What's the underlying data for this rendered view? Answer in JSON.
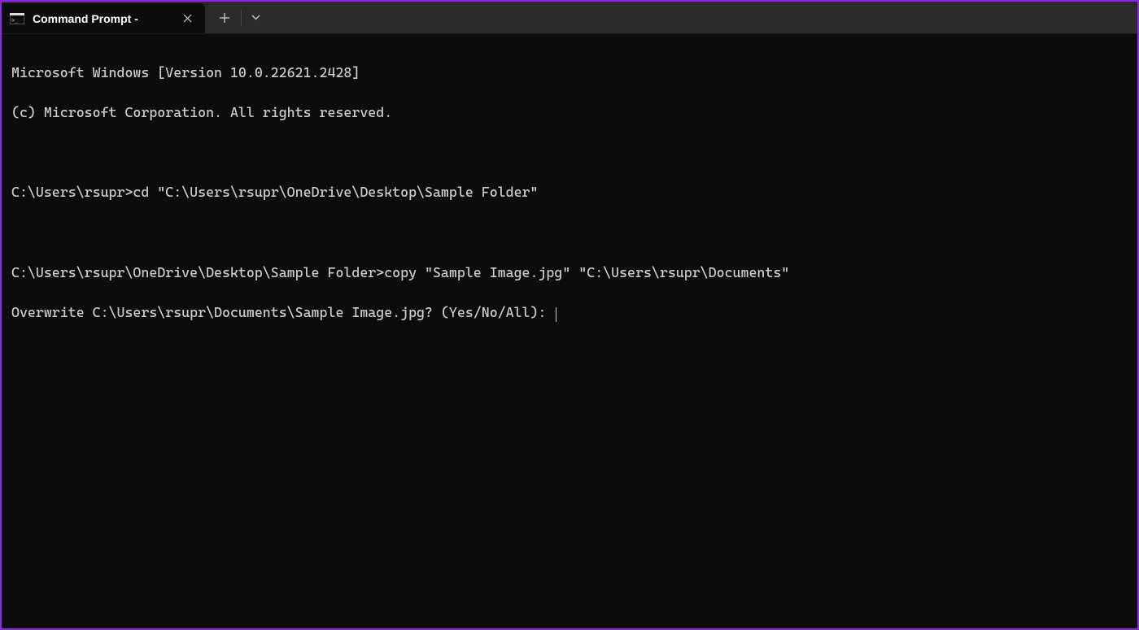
{
  "tab": {
    "title": "Command Prompt - "
  },
  "terminal": {
    "line1": "Microsoft Windows [Version 10.0.22621.2428]",
    "line2": "(c) Microsoft Corporation. All rights reserved.",
    "line3": "C:\\Users\\rsupr>cd \"C:\\Users\\rsupr\\OneDrive\\Desktop\\Sample Folder\"",
    "line4": "C:\\Users\\rsupr\\OneDrive\\Desktop\\Sample Folder>copy \"Sample Image.jpg\" \"C:\\Users\\rsupr\\Documents\"",
    "line5": "Overwrite C:\\Users\\rsupr\\Documents\\Sample Image.jpg? (Yes/No/All): "
  }
}
